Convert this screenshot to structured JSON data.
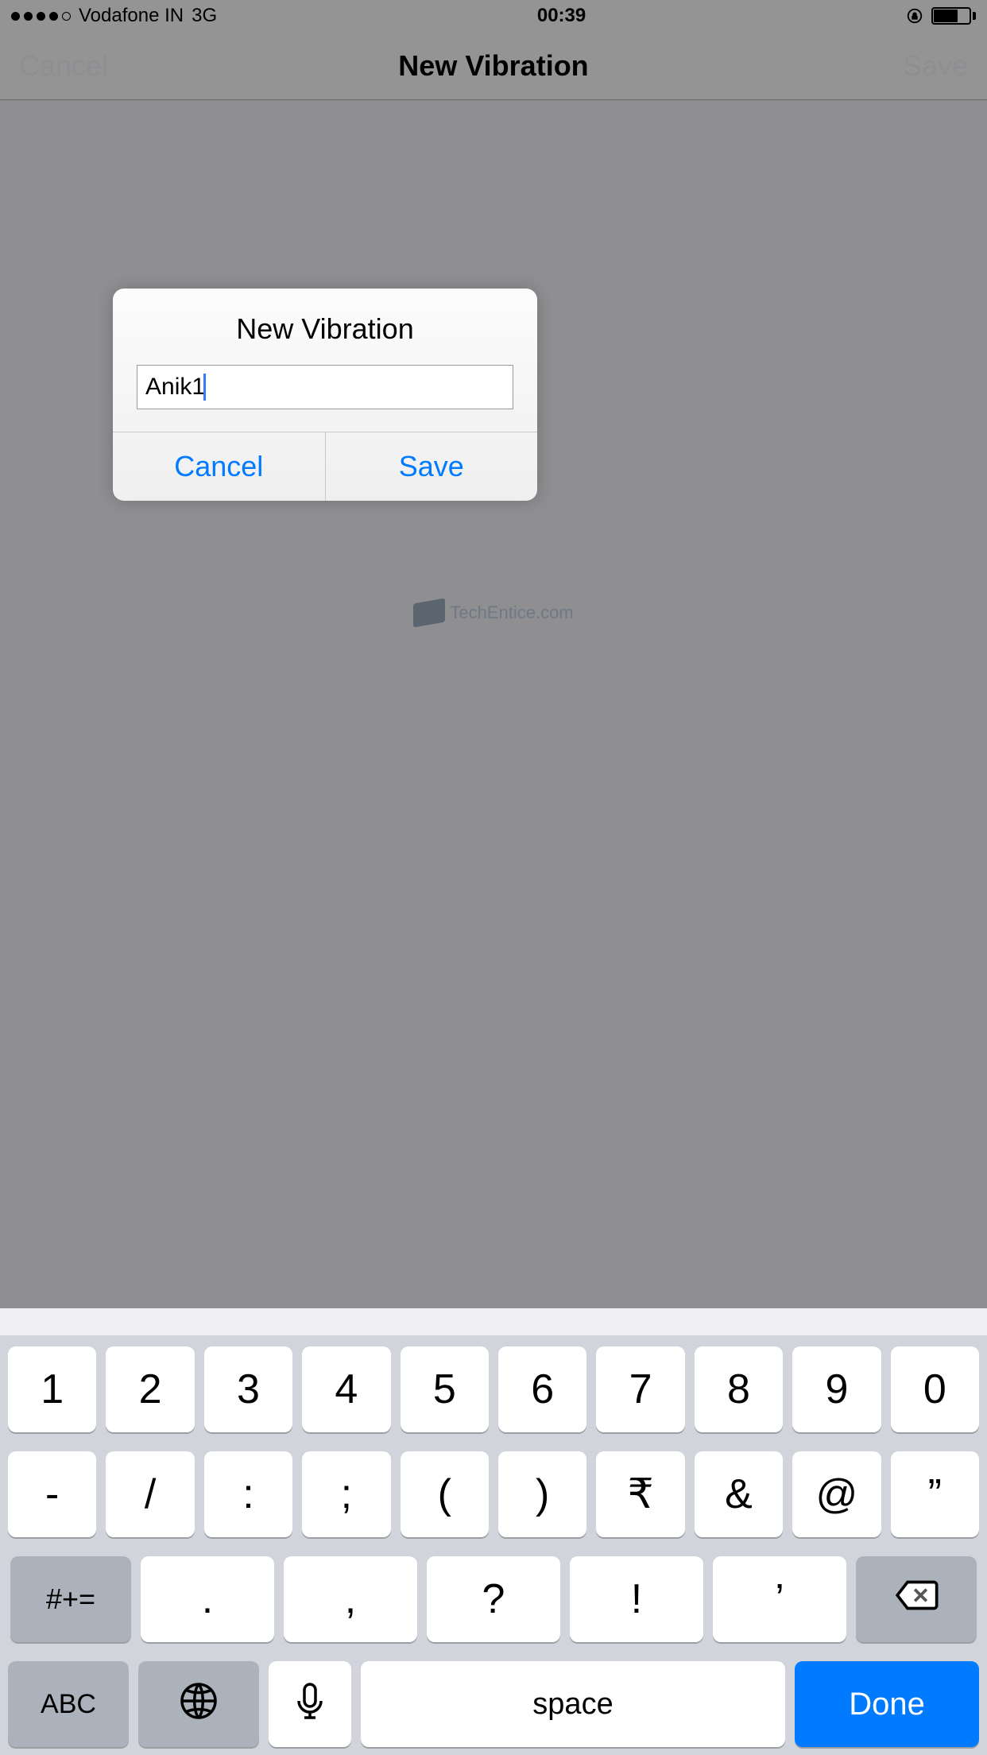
{
  "status": {
    "carrier": "Vodafone IN",
    "network": "3G",
    "time": "00:39"
  },
  "nav": {
    "cancel": "Cancel",
    "title": "New Vibration",
    "save": "Save"
  },
  "alert": {
    "title": "New Vibration",
    "input_value": "Anik1",
    "cancel": "Cancel",
    "save": "Save"
  },
  "watermark": {
    "text": "TechEntice.com"
  },
  "keyboard": {
    "row1": [
      "1",
      "2",
      "3",
      "4",
      "5",
      "6",
      "7",
      "8",
      "9",
      "0"
    ],
    "row2": [
      "-",
      "/",
      ":",
      ";",
      "(",
      ")",
      "₹",
      "&",
      "@",
      "”"
    ],
    "row3_func": "#+=",
    "row3": [
      ".",
      ",",
      "?",
      "!",
      "’"
    ],
    "row4_abc": "ABC",
    "row4_space": "space",
    "row4_done": "Done"
  }
}
